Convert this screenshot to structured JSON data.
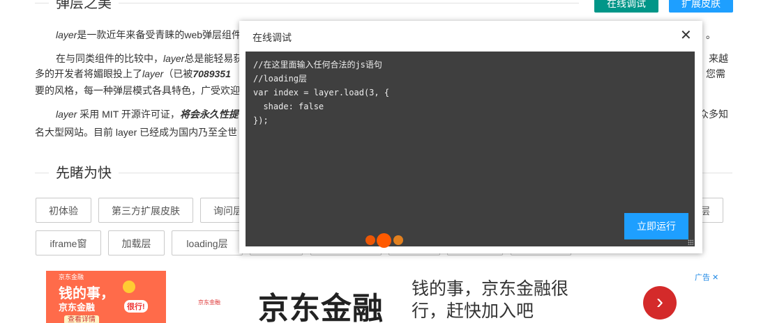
{
  "header": {
    "title": "弹层之美",
    "btn_debug": "在线调试",
    "btn_skin": "扩展皮肤"
  },
  "paragraphs": {
    "p1_a": "layer",
    "p1_b": "是一款近年来备受青睐的web弹层组件",
    "p1_tail": "。",
    "p2_a": "在与同类组件的比较中，",
    "p2_b": "layer",
    "p2_c": "总是能轻易获",
    "p2_right": "来越",
    "p3_a": "多的开发者将媚眼投上了",
    "p3_b": "layer",
    "p3_c": "（已被",
    "p3_d": "7089351",
    "p3_right": "您需",
    "p4_a": "要的风格，每一种弹层模式各具特色，广受欢迎",
    "p5_a": "layer",
    "p5_b": " 采用 MIT 开源许可证，",
    "p5_c": "将会永久性提",
    "p5_right": "众多知",
    "p6_a": "名大型网站。目前 layer 已经成为国内乃至全世"
  },
  "section2": {
    "title": "先睹为快"
  },
  "demos": {
    "row1": [
      "初体验",
      "第三方扩展皮肤",
      "询问层"
    ],
    "row1_right": "层",
    "row2": [
      "iframe窗",
      "加载层",
      "loading层"
    ]
  },
  "ad": {
    "left_line1": "钱的事，",
    "left_line2": "京东金融",
    "left_tag": "很行!",
    "left_top": "京东金融",
    "left_view": "查看详情",
    "small_logo": "京东金融",
    "big_text": "京东金融",
    "slogan": "钱的事，京东金融很行，赶快加入吧",
    "arrow": "›",
    "ad_mark": "广告 ✕"
  },
  "layer": {
    "title": "在线调试",
    "close": "✕",
    "code": "//在这里面输入任何合法的js语句\n//loading层\nvar index = layer.load(3, {\n  shade: false\n});",
    "run_label": "立即运行"
  },
  "colors": {
    "green": "#009688",
    "blue": "#1e9fff",
    "editor_bg": "#3f3f3f",
    "loading": "#ff5a00"
  }
}
